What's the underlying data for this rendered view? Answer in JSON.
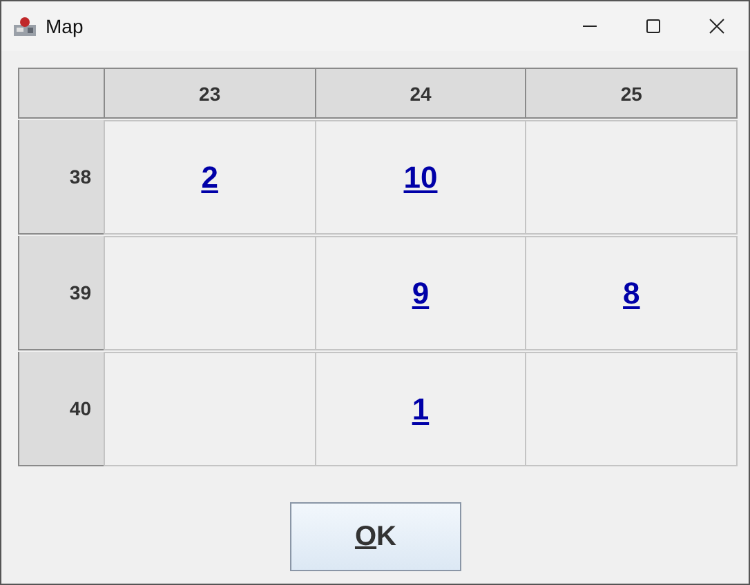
{
  "window": {
    "title": "Map"
  },
  "table": {
    "columns": [
      "23",
      "24",
      "25"
    ],
    "rows": [
      {
        "header": "38",
        "cells": [
          "2",
          "10",
          ""
        ]
      },
      {
        "header": "39",
        "cells": [
          "",
          "9",
          "8"
        ]
      },
      {
        "header": "40",
        "cells": [
          "",
          "1",
          ""
        ]
      }
    ]
  },
  "ok_button": {
    "mnemonic": "O",
    "rest": "K"
  }
}
